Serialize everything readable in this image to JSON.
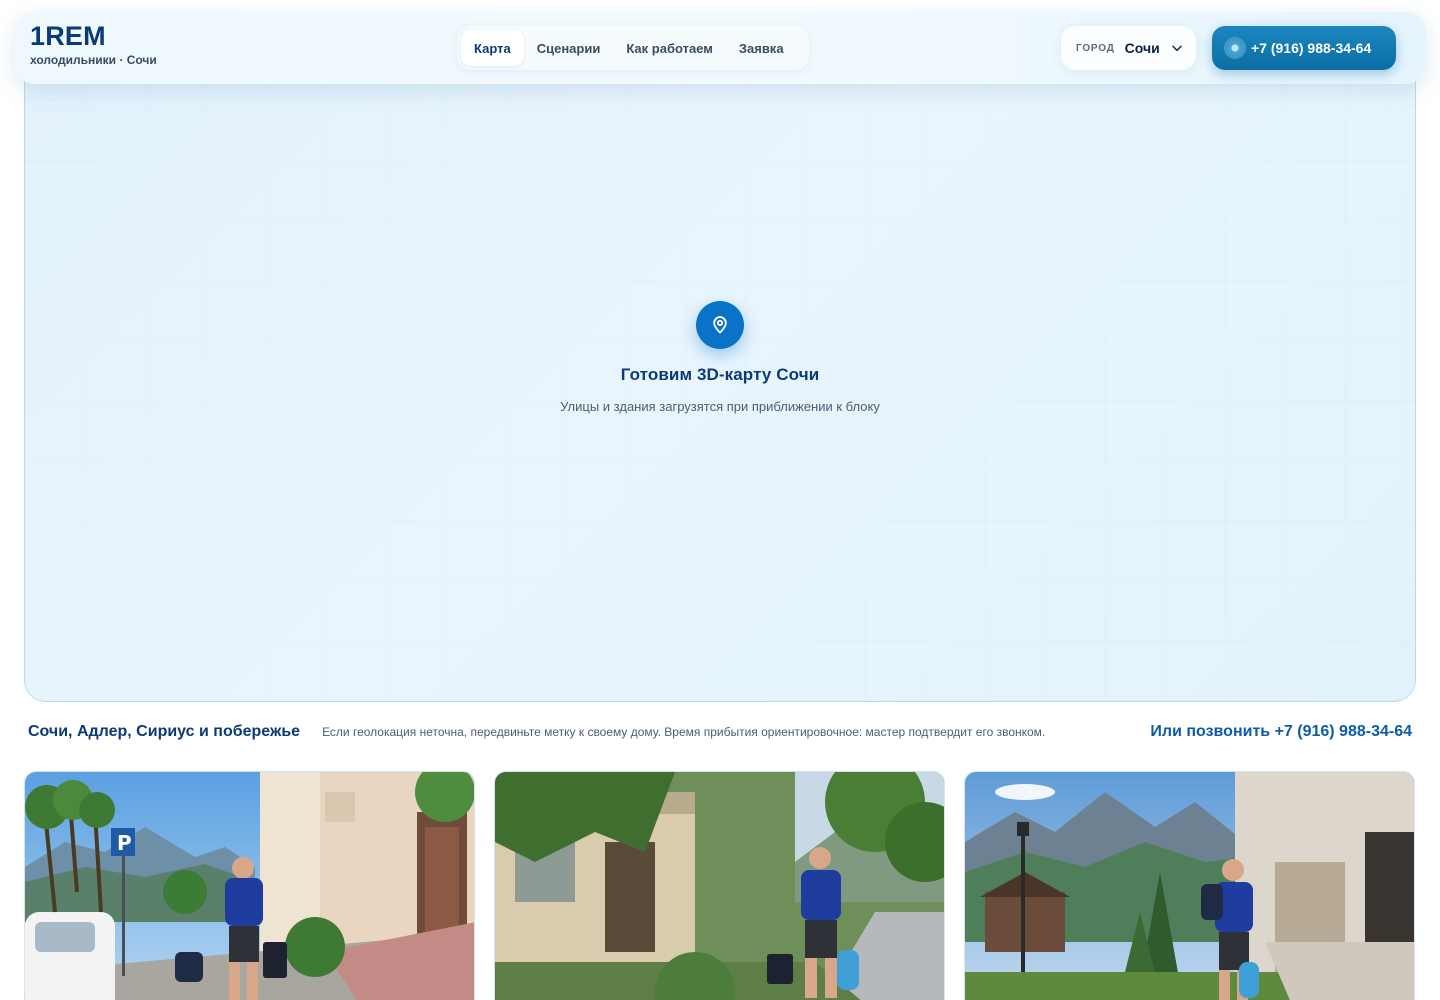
{
  "header": {
    "brand_logo": "1REM",
    "brand_sub": "холодильники · Сочи",
    "nav": [
      {
        "label": "Карта",
        "active": true
      },
      {
        "label": "Сценарии",
        "active": false
      },
      {
        "label": "Как работаем",
        "active": false
      },
      {
        "label": "Заявка",
        "active": false
      }
    ],
    "city_label": "ГОРОД",
    "city_value": "Сочи",
    "phone": "+7 (916) 988-34-64"
  },
  "map": {
    "icon": "map-pin-icon",
    "title": "Готовим 3D-карту Сочи",
    "subtitle": "Улицы и здания загрузятся при приближении к блоку"
  },
  "info": {
    "region": "Сочи, Адлер, Сириус и побережье",
    "hint": "Если геолокация неточна, передвиньте метку к своему дому. Время прибытия ориентировочное: мастер подтвердит его звонком.",
    "call": "Или позвонить +7 (916) 988-34-64"
  },
  "cards": [
    {
      "name": "photo-card-embankment"
    },
    {
      "name": "photo-card-courtyard"
    },
    {
      "name": "photo-card-mountains"
    }
  ],
  "colors": {
    "brand": "#0b3a78",
    "accent": "#0a72c9",
    "phone_button": "#0b6ea4",
    "map_bg": "#e6f3fc"
  }
}
